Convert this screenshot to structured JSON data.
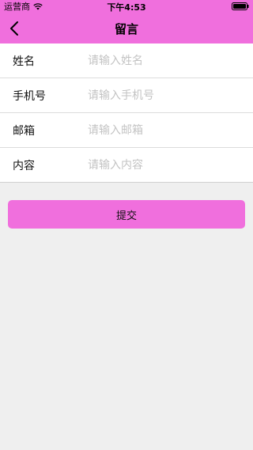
{
  "status_bar": {
    "carrier": "运营商",
    "time": "下午4:53"
  },
  "nav": {
    "title": "留言",
    "back_icon": "chevron-left-icon"
  },
  "form": {
    "fields": [
      {
        "label": "姓名",
        "placeholder": "请输入姓名",
        "value": ""
      },
      {
        "label": "手机号",
        "placeholder": "请输入手机号",
        "value": ""
      },
      {
        "label": "邮箱",
        "placeholder": "请输入邮箱",
        "value": ""
      },
      {
        "label": "内容",
        "placeholder": "请输入内容",
        "value": ""
      }
    ]
  },
  "submit": {
    "label": "提交"
  },
  "colors": {
    "accent": "#f06fdd",
    "background": "#efefef"
  }
}
